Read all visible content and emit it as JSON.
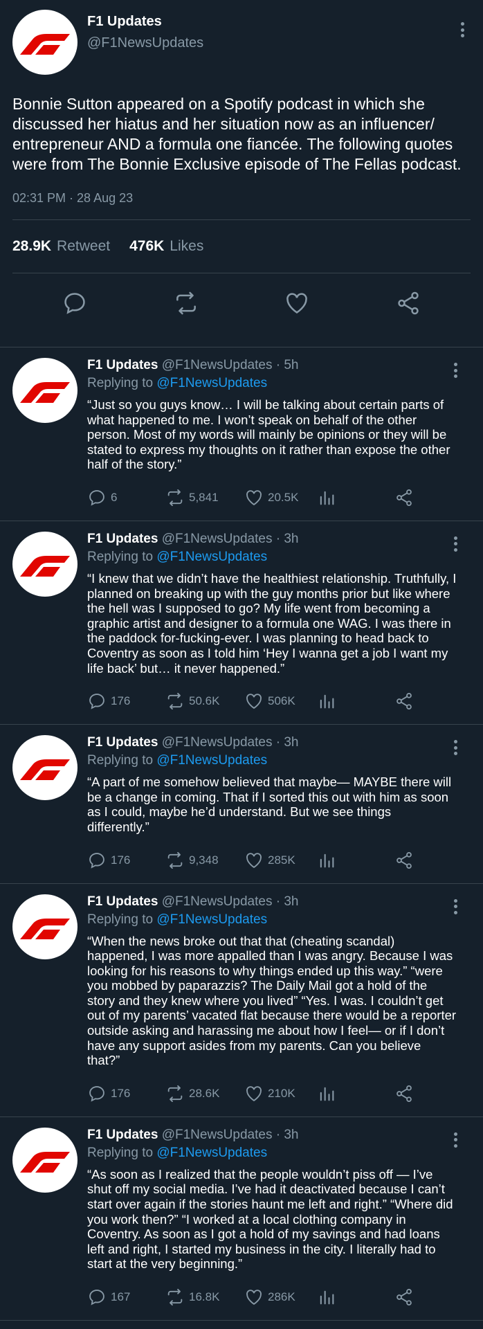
{
  "main": {
    "name": "F1 Updates",
    "handle": "@F1NewsUpdates",
    "text": "Bonnie Sutton appeared on a Spotify podcast in which she discussed her hiatus and her situation now as an influencer/ entrepreneur AND a formula one fiancée. The following quotes were from The Bonnie Exclusive episode of The Fellas podcast.",
    "timestamp": "02:31 PM · 28 Aug 23",
    "retweets": "28.9K",
    "retweets_label": "Retweet",
    "likes": "476K",
    "likes_label": "Likes"
  },
  "replies": [
    {
      "name": "F1 Updates",
      "meta": "@F1NewsUpdates · 5h",
      "replying_prefix": "Replying to",
      "replying_to": "@F1NewsUpdates",
      "text": "“Just so you guys know… I will be talking about certain parts of what happened to me. I won’t speak on behalf of the other person. Most of my words will mainly be opinions or they will be stated to express my thoughts on it rather than expose the other half of the story.”",
      "reply_count": "6",
      "retweet_count": "5,841",
      "like_count": "20.5K"
    },
    {
      "name": "F1 Updates",
      "meta": "@F1NewsUpdates · 3h",
      "replying_prefix": "Replying to",
      "replying_to": "@F1NewsUpdates",
      "text": "“I knew that we didn’t have the healthiest relationship. Truthfully, I planned on breaking up with the guy months prior but like where the hell was I supposed to go? My life went from becoming a graphic artist and designer to a formula one WAG. I was there in the paddock for-fucking-ever. I was planning to head back to Coventry as soon as I told him ‘Hey I wanna get a job I want my life back’ but… it never happened.”",
      "reply_count": "176",
      "retweet_count": "50.6K",
      "like_count": "506K"
    },
    {
      "name": "F1 Updates",
      "meta": "@F1NewsUpdates · 3h",
      "replying_prefix": "Replying to",
      "replying_to": "@F1NewsUpdates",
      "text": "“A part of me somehow believed that maybe— MAYBE there will be a change in coming. That if I sorted this out with him as soon as I could, maybe he’d understand. But we see things differently.”",
      "reply_count": "176",
      "retweet_count": "9,348",
      "like_count": "285K"
    },
    {
      "name": "F1 Updates",
      "meta": "@F1NewsUpdates · 3h",
      "replying_prefix": "Replying to",
      "replying_to": "@F1NewsUpdates",
      "text": "“When the news broke out that that (cheating scandal) happened, I was more appalled than I was angry. Because I was looking for his reasons to why things ended up this way.” “were you mobbed by paparazzis? The Daily Mail got a hold of the story and they knew where you lived” “Yes. I was. I couldn’t get out of my parents’ vacated flat because there would be a reporter outside asking and harassing me about how I feel— or if I don’t have any support asides from my parents. Can you believe that?”",
      "reply_count": "176",
      "retweet_count": "28.6K",
      "like_count": "210K"
    },
    {
      "name": "F1 Updates",
      "meta": "@F1NewsUpdates · 3h",
      "replying_prefix": "Replying to",
      "replying_to": "@F1NewsUpdates",
      "text": "“As soon as I realized that the people wouldn’t piss off — I’ve shut off my social media. I’ve had it deactivated because I can’t start over again if the stories haunt me left and right.” “Where did you work then?” “I worked at a local clothing company in Coventry. As soon as I got a hold of my savings and had loans left and right, I started my business in the city. I literally had to start at the very beginning.”",
      "reply_count": "167",
      "retweet_count": "16.8K",
      "like_count": "286K"
    }
  ],
  "colors": {
    "background": "#15202b",
    "divider": "#38444d",
    "secondary_text": "#8899a6",
    "mention": "#1d9bf0",
    "logo_red": "#e10600"
  },
  "icons": [
    "f1-logo-icon",
    "more-vertical-icon",
    "reply-icon",
    "retweet-icon",
    "like-icon",
    "stats-icon",
    "share-icon"
  ]
}
